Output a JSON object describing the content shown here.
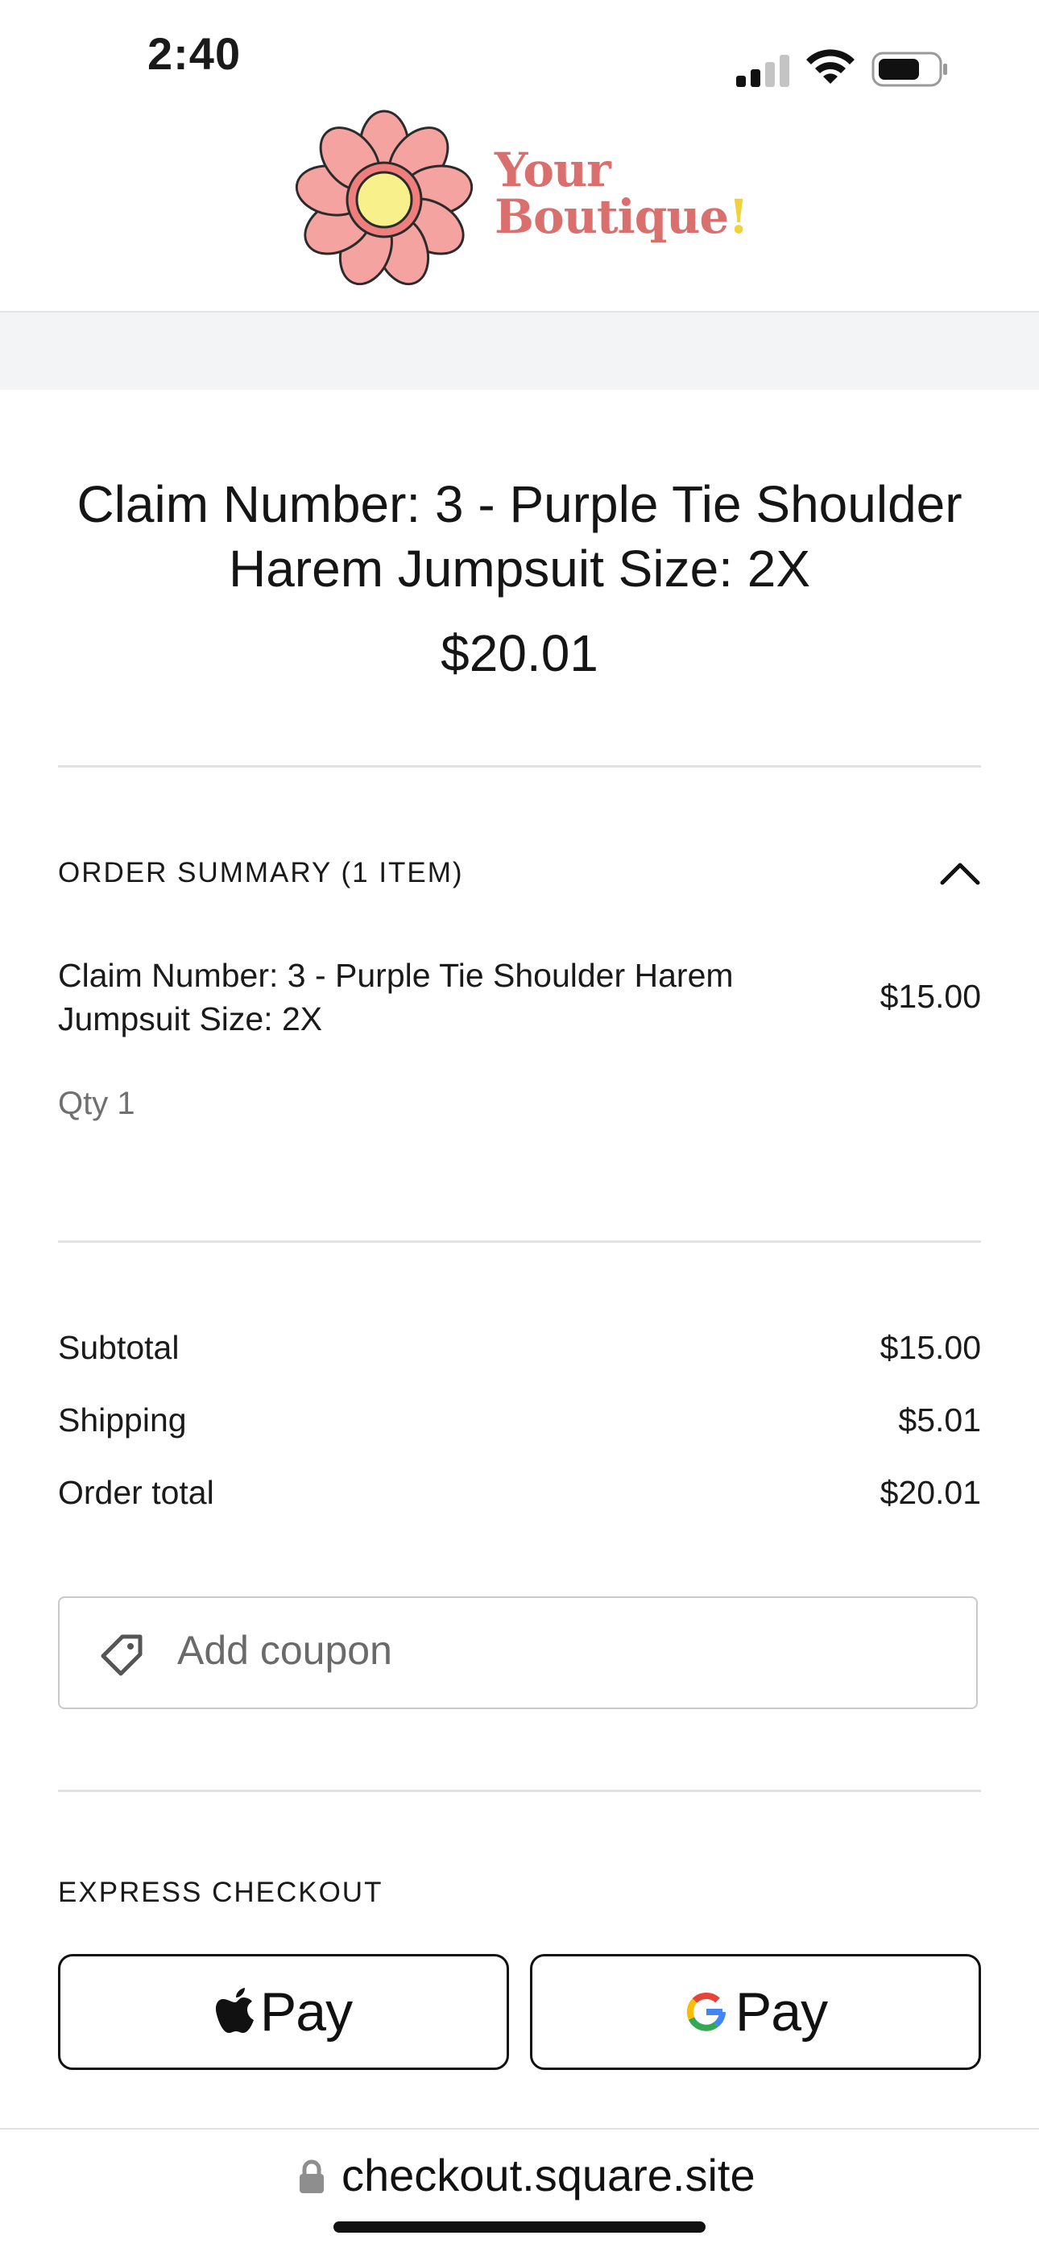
{
  "status_bar": {
    "time": "2:40"
  },
  "header": {
    "logo_line1": "Your",
    "logo_line2": "Boutique",
    "logo_bang": "!"
  },
  "title": "Claim Number: 3 - Purple Tie Shoulder Harem Jumpsuit Size: 2X",
  "total_display": "$20.01",
  "order_summary": {
    "heading": "ORDER SUMMARY (1 ITEM)",
    "items": [
      {
        "name": "Claim Number: 3 - Purple Tie Shoulder Harem Jumpsuit Size: 2X",
        "price": "$15.00",
        "qty": "Qty 1"
      }
    ]
  },
  "totals": {
    "subtotal_label": "Subtotal",
    "subtotal_value": "$15.00",
    "shipping_label": "Shipping",
    "shipping_value": "$5.01",
    "order_total_label": "Order total",
    "order_total_value": "$20.01"
  },
  "coupon": {
    "placeholder": "Add coupon"
  },
  "express_checkout": {
    "heading": "EXPRESS CHECKOUT",
    "apple_pay_label": "Pay",
    "google_pay_label": "Pay"
  },
  "browser": {
    "url": "checkout.square.site"
  },
  "colors": {
    "brand_text": "#d9706e",
    "brand_accent": "#f1d23c",
    "petal": "#f4a3a0",
    "divider": "#e2e2e2"
  }
}
